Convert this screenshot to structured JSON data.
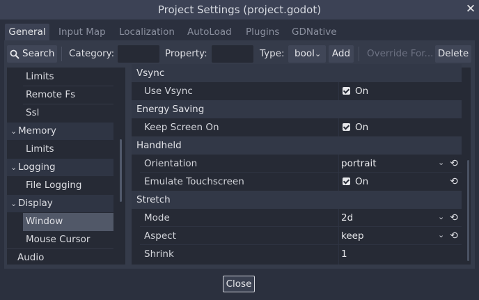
{
  "window": {
    "title": "Project Settings (project.godot)",
    "close_icon": "close-icon"
  },
  "tabs": [
    {
      "label": "General",
      "active": true
    },
    {
      "label": "Input Map"
    },
    {
      "label": "Localization"
    },
    {
      "label": "AutoLoad"
    },
    {
      "label": "Plugins"
    },
    {
      "label": "GDNative"
    }
  ],
  "toolbar": {
    "search_label": "Search",
    "search_icon": "search-icon",
    "category_label": "Category:",
    "category_value": "",
    "property_label": "Property:",
    "property_value": "",
    "type_label": "Type:",
    "type_value": "bool",
    "add_label": "Add",
    "override_label": "Override For...",
    "delete_label": "Delete"
  },
  "tree": {
    "items": [
      {
        "label": "Limits",
        "level": 2
      },
      {
        "label": "Remote Fs",
        "level": 2
      },
      {
        "label": "Ssl",
        "level": 2
      },
      {
        "label": "Memory",
        "level": 1,
        "expanded": true
      },
      {
        "label": "Limits",
        "level": 2
      },
      {
        "label": "Logging",
        "level": 1,
        "expanded": true
      },
      {
        "label": "File Logging",
        "level": 2
      },
      {
        "label": "Display",
        "level": 1,
        "expanded": true
      },
      {
        "label": "Window",
        "level": 2,
        "selected": true
      },
      {
        "label": "Mouse Cursor",
        "level": 2
      },
      {
        "label": "Audio",
        "level": 1
      }
    ]
  },
  "inspector": {
    "sections": [
      {
        "title": "Vsync",
        "props": [
          {
            "label": "Use Vsync",
            "type": "check",
            "value": "On",
            "checked": true
          }
        ]
      },
      {
        "title": "Energy Saving",
        "props": [
          {
            "label": "Keep Screen On",
            "type": "check",
            "value": "On",
            "checked": true
          }
        ]
      },
      {
        "title": "Handheld",
        "props": [
          {
            "label": "Orientation",
            "type": "enum",
            "value": "portrait",
            "revertable": true
          },
          {
            "label": "Emulate Touchscreen",
            "type": "check",
            "value": "On",
            "checked": true,
            "revertable": true
          }
        ]
      },
      {
        "title": "Stretch",
        "props": [
          {
            "label": "Mode",
            "type": "enum",
            "value": "2d",
            "revertable": true
          },
          {
            "label": "Aspect",
            "type": "enum",
            "value": "keep",
            "revertable": true
          },
          {
            "label": "Shrink",
            "type": "number",
            "value": "1"
          }
        ]
      }
    ]
  },
  "footer": {
    "close_label": "Close"
  },
  "colors": {
    "background": "#2b303e",
    "panel": "#353b4a",
    "field": "#262a35",
    "selected": "#515868"
  }
}
